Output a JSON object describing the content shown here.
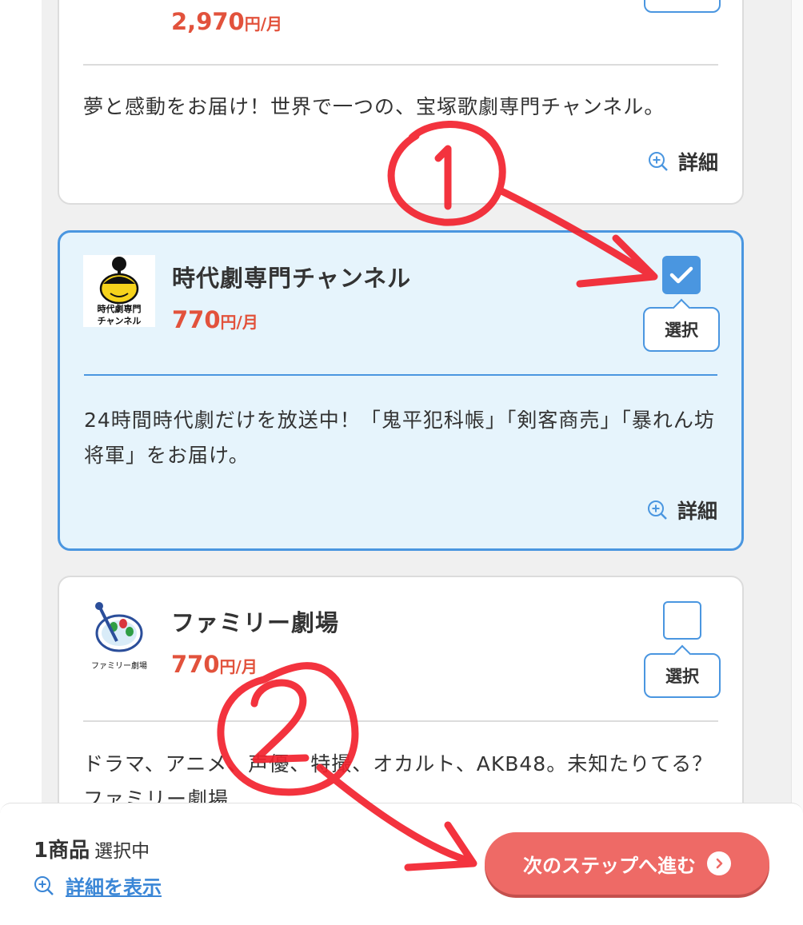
{
  "cards": [
    {
      "price_amount": "2,970",
      "price_unit": "円/月",
      "description": "夢と感動をお届け！世界で一つの、宝塚歌劇専門チャンネル。",
      "detail_label": "詳細"
    },
    {
      "title": "時代劇専門チャンネル",
      "logo_text_line1": "時代劇専門",
      "logo_text_line2": "チャンネル",
      "price_amount": "770",
      "price_unit": "円/月",
      "checked": true,
      "select_label": "選択",
      "description": "24時間時代劇だけを放送中！「鬼平犯科帳」「剣客商売」「暴れん坊将軍」をお届け。",
      "detail_label": "詳細"
    },
    {
      "title": "ファミリー劇場",
      "logo_text": "ファミリー劇場",
      "price_amount": "770",
      "price_unit": "円/月",
      "checked": false,
      "select_label": "選択",
      "description": "ドラマ、アニメ、声優、特撮、オカルト、AKB48。未知たりてる？ファミリー劇場"
    }
  ],
  "footer": {
    "count_label": "1商品",
    "count_suffix": "選択中",
    "show_detail_label": "詳細を表示",
    "next_button_label": "次のステップへ進む"
  },
  "annotations": [
    "①",
    "②"
  ],
  "colors": {
    "accent_blue": "#4a96e0",
    "price_red": "#e2523c",
    "next_button": "#ee6a66",
    "selected_bg": "#e6f4fc",
    "annotation_red": "#f2222e"
  }
}
